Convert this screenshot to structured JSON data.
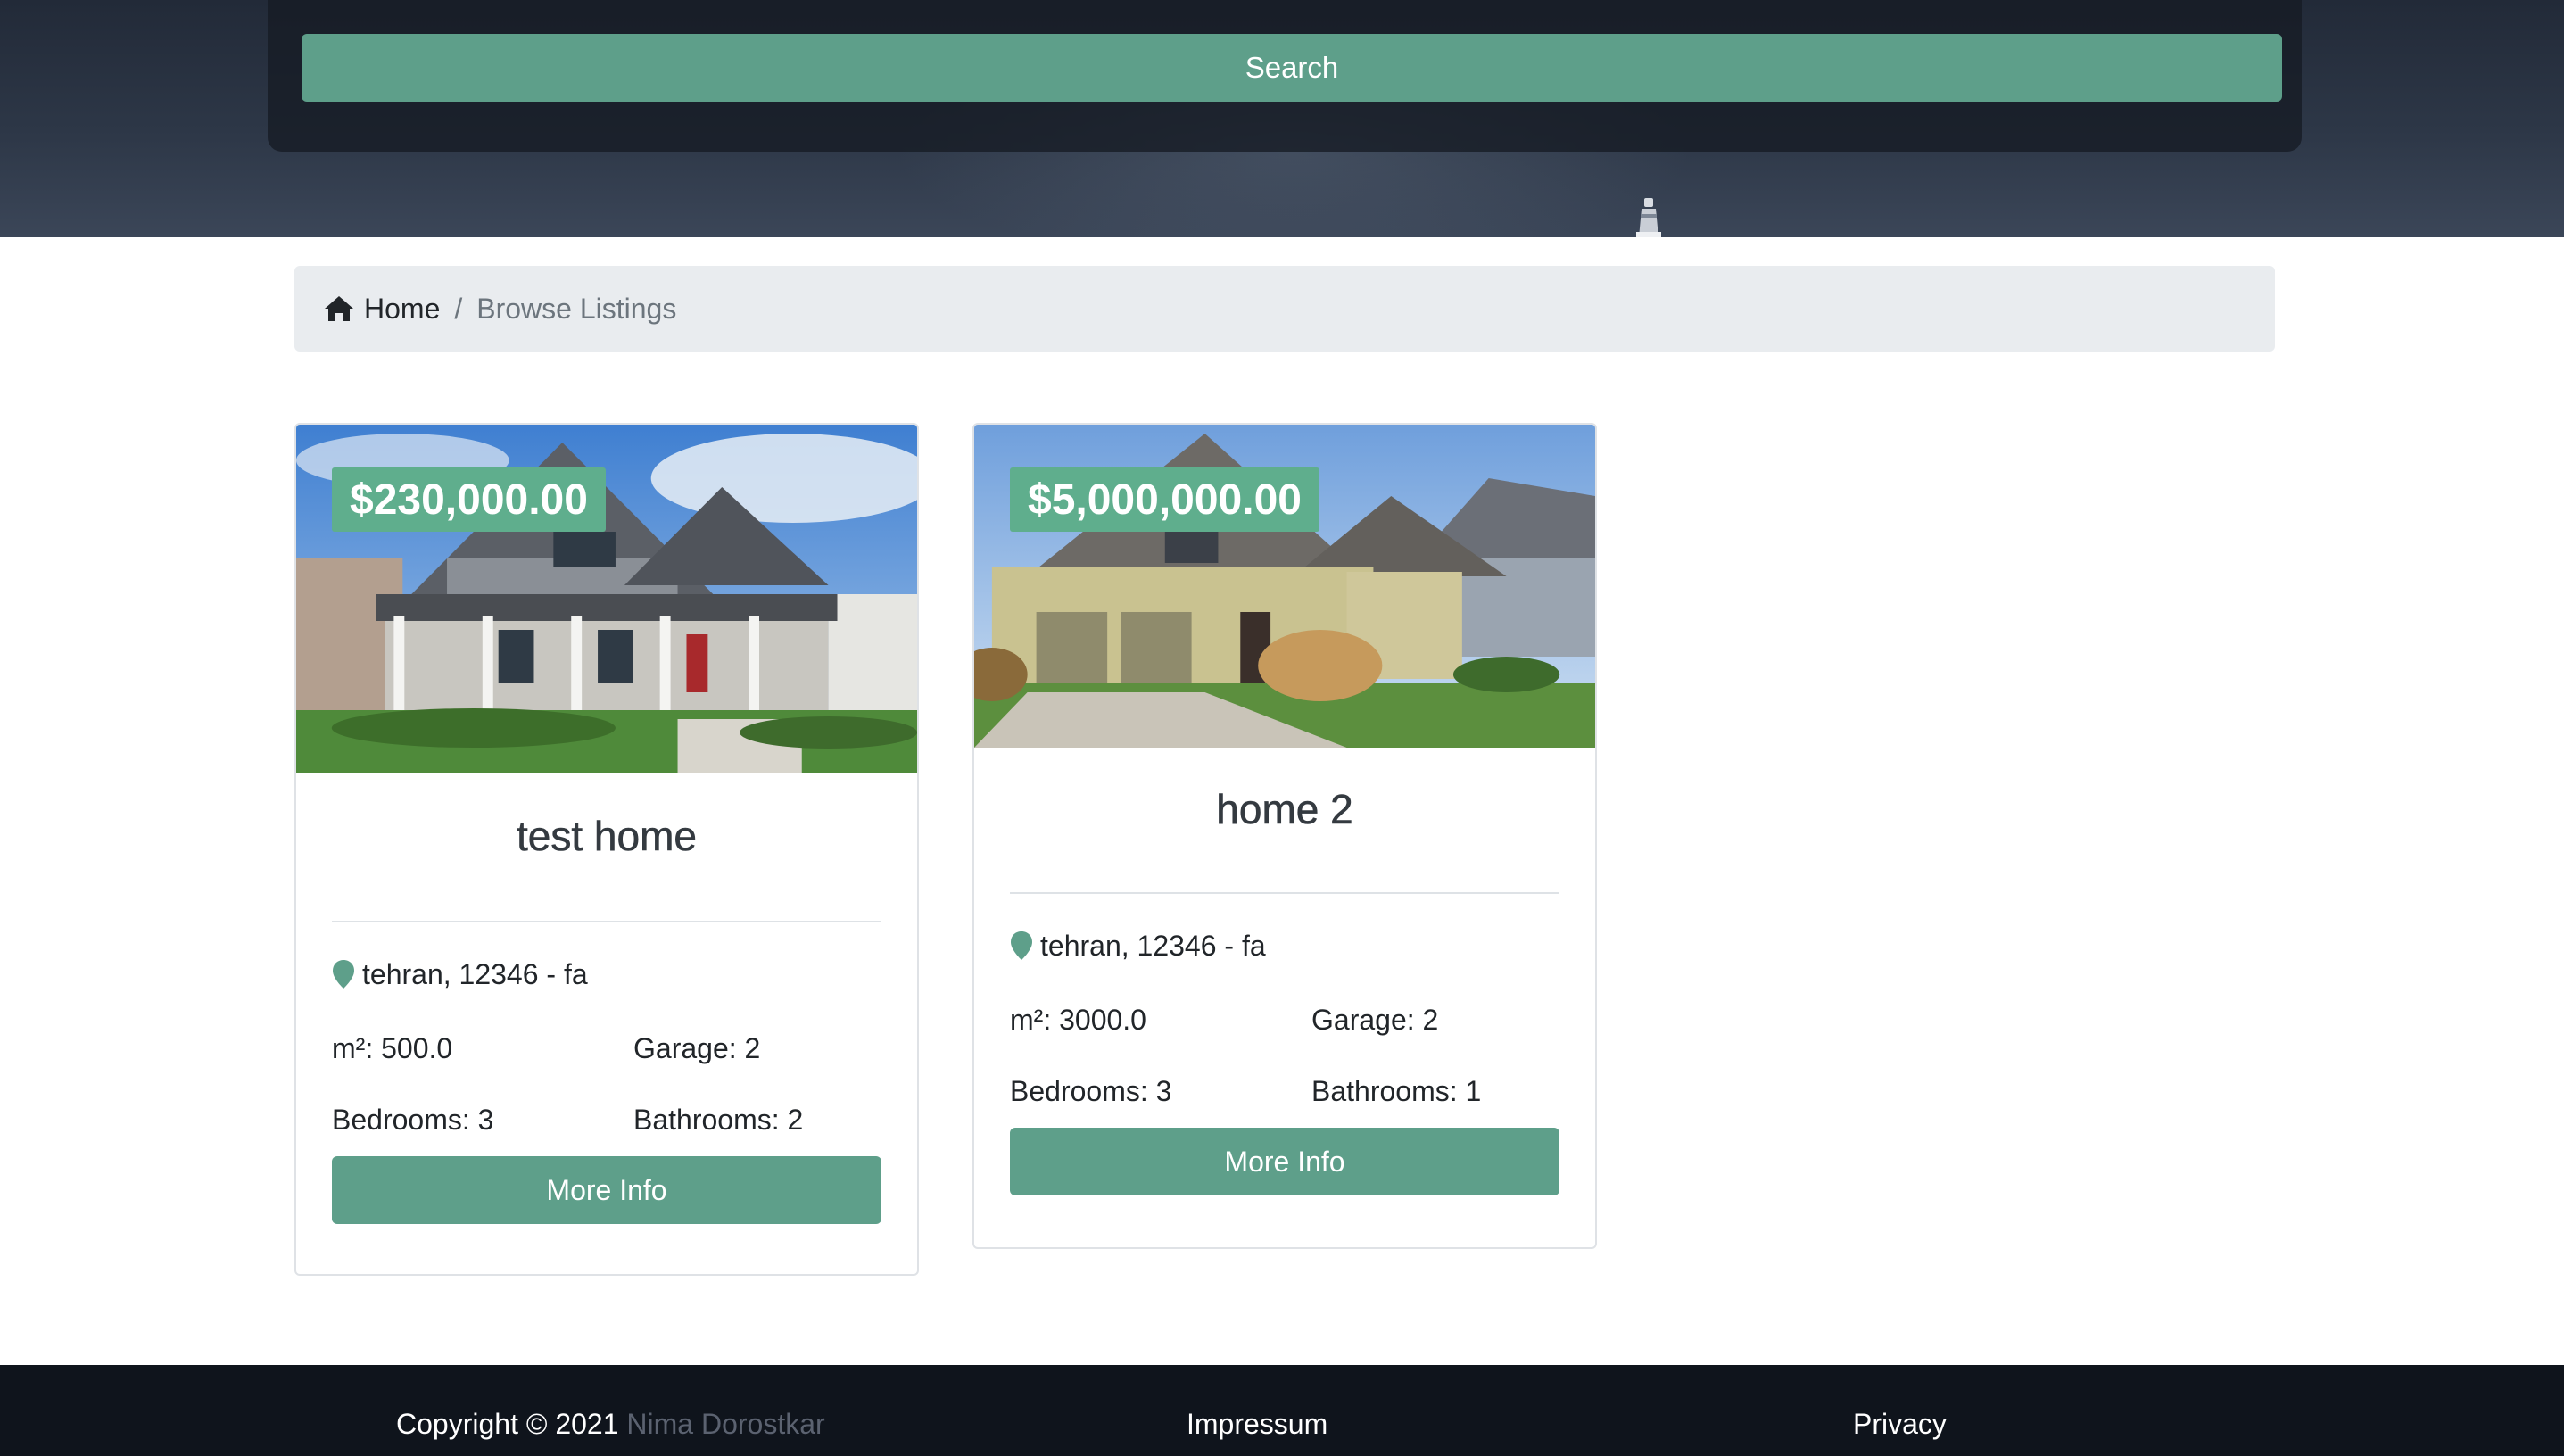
{
  "hero": {
    "search_label": "Search"
  },
  "breadcrumb": {
    "home_label": "Home",
    "separator": "/",
    "current_label": "Browse Listings"
  },
  "listings": [
    {
      "price": "$230,000.00",
      "title": "test home",
      "location": "tehran, 12346 - fa",
      "area": "m²: 500.0",
      "garage": "Garage: 2",
      "bedrooms": "Bedrooms: 3",
      "bathrooms": "Bathrooms: 2",
      "button_label": "More Info"
    },
    {
      "price": "$5,000,000.00",
      "title": "home 2",
      "location": "tehran, 12346 - fa",
      "area": "m²: 3000.0",
      "garage": "Garage: 2",
      "bedrooms": "Bedrooms: 3",
      "bathrooms": "Bathrooms: 1",
      "button_label": "More Info"
    }
  ],
  "footer": {
    "copyright": "Copyright © 2021",
    "author": "Nima Dorostkar",
    "impressum": "Impressum",
    "privacy": "Privacy"
  },
  "colors": {
    "accent": "#5e9f8a",
    "price_badge": "#5fae8d",
    "footer_bg": "#0f141c",
    "hero_bg": "#2d3747"
  },
  "icons": {
    "breadcrumb_home": "home-icon",
    "location": "map-marker-icon"
  }
}
